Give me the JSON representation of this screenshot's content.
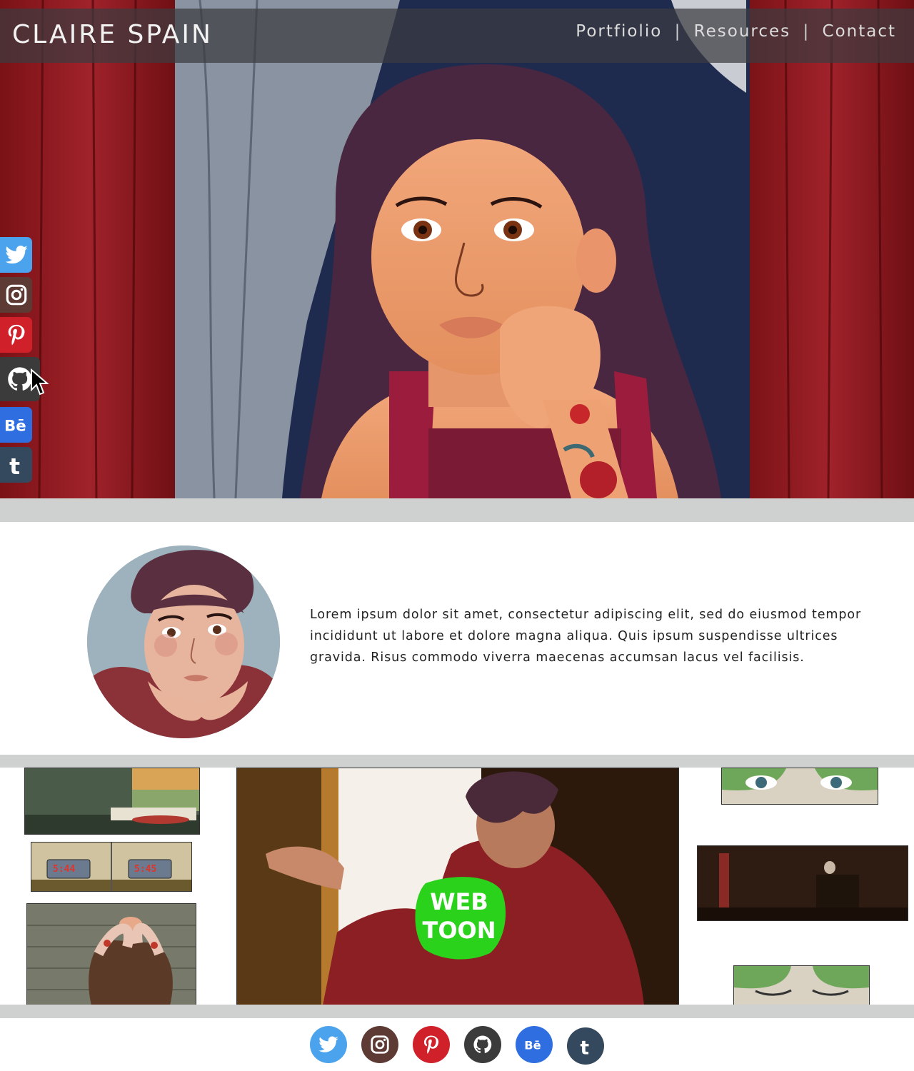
{
  "header": {
    "brand": "CLAIRE SPAIN",
    "nav": [
      "Portfiolio",
      "|",
      "Resources",
      "|",
      "Contact"
    ]
  },
  "social": [
    {
      "name": "twitter",
      "icon": "twitter-icon",
      "color": "#4aa3ec"
    },
    {
      "name": "instagram",
      "icon": "instagram-icon",
      "color": "#5d3a33"
    },
    {
      "name": "pinterest",
      "icon": "pinterest-icon",
      "color": "#d0202a"
    },
    {
      "name": "github",
      "icon": "github-icon",
      "color": "#3b3b3b"
    },
    {
      "name": "behance",
      "icon": "behance-icon",
      "color": "#2f6ee0"
    },
    {
      "name": "tumblr",
      "icon": "tumblr-icon",
      "color": "#34495e"
    }
  ],
  "about": {
    "text": "Lorem ipsum dolor sit amet, consectetur adipiscing elit, sed do eiusmod tempor incididunt ut labore et dolore magna aliqua. Quis ipsum suspendisse ultrices gravida. Risus commodo viverra maecenas accumsan lacus vel facilisis."
  },
  "gallery": {
    "clock_left": "5:44",
    "clock_right": "5:45",
    "badge_line1": "WEB",
    "badge_line2": "TOON"
  },
  "colors": {
    "band": "#cfd1d1",
    "webtoon": "#2bd21b",
    "curtain": "#8e1a1e"
  }
}
